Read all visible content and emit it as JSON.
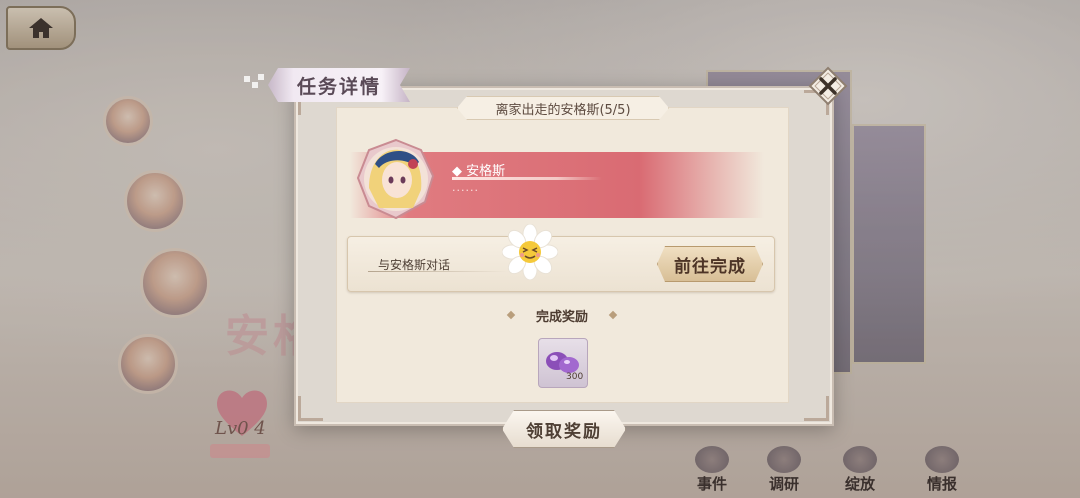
{
  "panel": {
    "title": "任务详情",
    "quest_title": "离家出走的安格斯(5/5)"
  },
  "character": {
    "name": "◆ 安格斯",
    "description": "······"
  },
  "task": {
    "objective": "与安格斯对话",
    "goto_label": "前往完成"
  },
  "reward": {
    "section_label": "完成奖励",
    "items": [
      {
        "icon": "purple-gem-icon",
        "quantity": "300"
      }
    ]
  },
  "buttons": {
    "claim_label": "领取奖励",
    "close_icon": "close-icon",
    "home_icon": "home-icon"
  },
  "background": {
    "title_fragment": "安格",
    "level": "Lv0 4",
    "bottom_menu": [
      "事件",
      "调研",
      "绽放",
      "情报"
    ]
  },
  "colors": {
    "banner": "#d96b73",
    "panel": "#f1e9dc",
    "button": "#d8bf96"
  }
}
